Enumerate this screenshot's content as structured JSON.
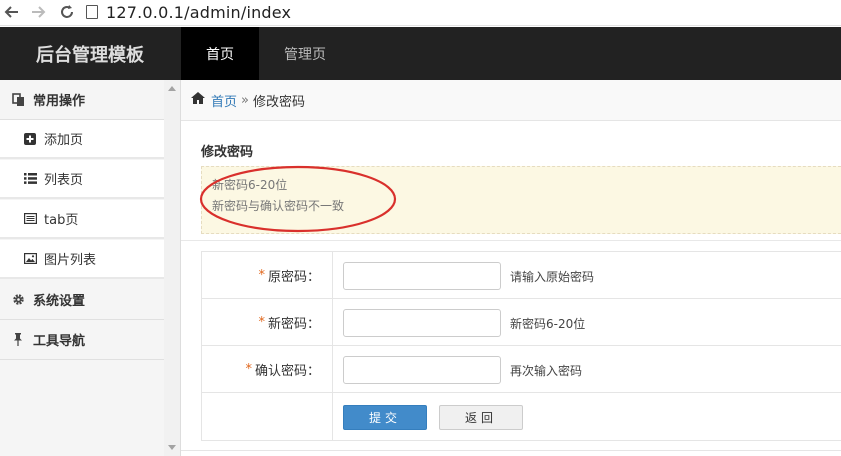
{
  "browser": {
    "url": "127.0.0.1/admin/index"
  },
  "header": {
    "brand": "后台管理模板",
    "tabs": [
      {
        "label": "首页",
        "active": true
      },
      {
        "label": "管理页",
        "active": false
      }
    ]
  },
  "sidebar": {
    "groups": [
      {
        "label": "常用操作",
        "icon": "copy-icon",
        "items": [
          {
            "label": "添加页",
            "icon": "plus-square-icon"
          },
          {
            "label": "列表页",
            "icon": "list-icon"
          },
          {
            "label": "tab页",
            "icon": "list-alt-icon"
          },
          {
            "label": "图片列表",
            "icon": "picture-icon"
          }
        ]
      },
      {
        "label": "系统设置",
        "icon": "gear-icon"
      },
      {
        "label": "工具导航",
        "icon": "pushpin-icon"
      }
    ]
  },
  "breadcrumb": {
    "home": "首页",
    "separator": "»",
    "current": "修改密码"
  },
  "main": {
    "title": "修改密码",
    "alert": {
      "lines": [
        "新密码6-20位",
        "新密码与确认密码不一致"
      ]
    },
    "form": {
      "fields": [
        {
          "label": "原密码：",
          "required": "*",
          "value": "",
          "hint": "请输入原始密码"
        },
        {
          "label": "新密码：",
          "required": "*",
          "value": "",
          "hint": "新密码6-20位"
        },
        {
          "label": "确认密码：",
          "required": "*",
          "value": "",
          "hint": "再次输入密码"
        }
      ],
      "submit_label": "提交",
      "back_label": "返回"
    }
  },
  "colors": {
    "topbar": "#222222",
    "active_tab": "#000000",
    "link": "#337ab7",
    "primary_button": "#428bca",
    "alert_bg": "#fcf8e3",
    "required_star": "#e0661c",
    "annotation_oval": "#d9302c"
  }
}
